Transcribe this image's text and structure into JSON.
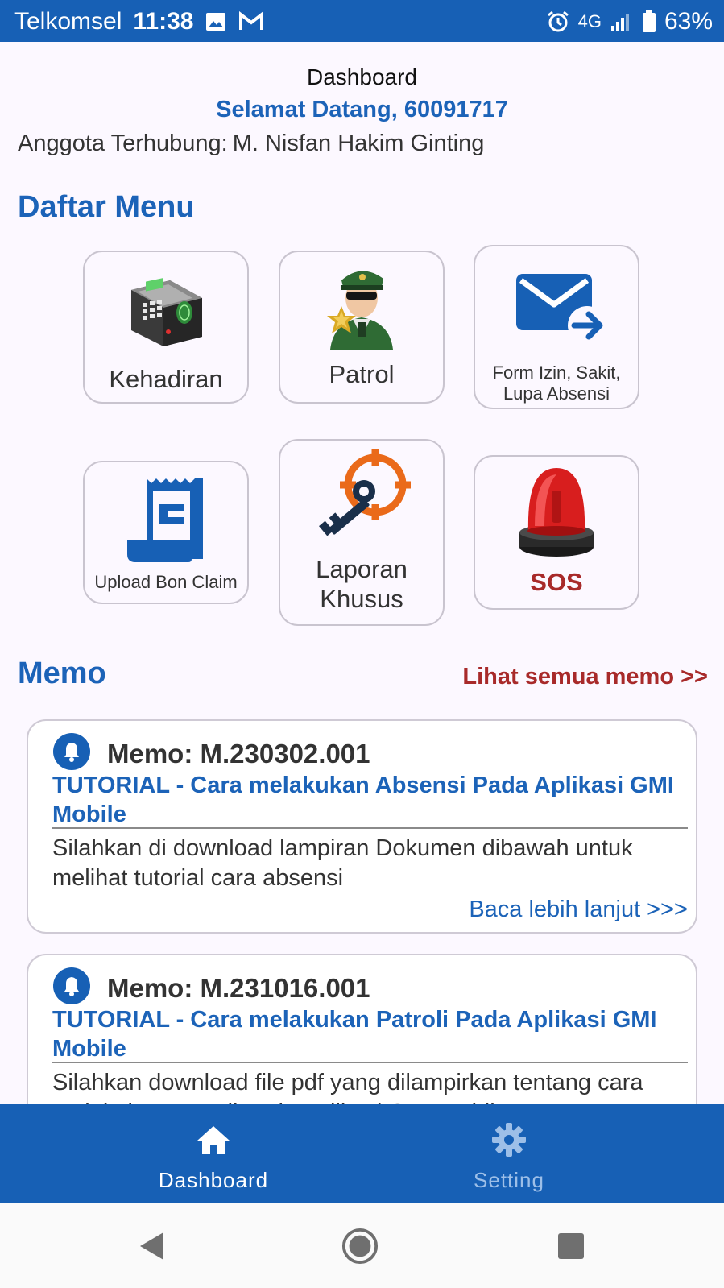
{
  "status_bar": {
    "carrier": "Telkomsel",
    "time": "11:38",
    "network": "4G",
    "battery": "63%"
  },
  "header": {
    "title": "Dashboard",
    "welcome": "Selamat Datang, 60091717",
    "member_label": "Anggota Terhubung:",
    "member_name": "M. Nisfan Hakim Ginting"
  },
  "menu": {
    "title": "Daftar Menu",
    "items": [
      {
        "label": "Kehadiran",
        "icon": "fingerprint-terminal-icon"
      },
      {
        "label": "Patrol",
        "icon": "security-officer-icon"
      },
      {
        "label": "Form Izin, Sakit, Lupa Absensi",
        "icon": "mail-forward-icon"
      },
      {
        "label": "Upload Bon Claim",
        "icon": "receipt-icon"
      },
      {
        "label": "Laporan Khusus",
        "icon": "key-target-icon"
      },
      {
        "label": "SOS",
        "icon": "siren-icon"
      }
    ]
  },
  "memo": {
    "title": "Memo",
    "view_all": "Lihat semua memo >>",
    "items": [
      {
        "number": "Memo: M.230302.001",
        "title": "TUTORIAL - Cara melakukan Absensi Pada Aplikasi GMI Mobile",
        "body": "Silahkan di download lampiran Dokumen dibawah untuk melihat tutorial cara absensi",
        "read_more": "Baca lebih lanjut >>>"
      },
      {
        "number": "Memo: M.231016.001",
        "title": "TUTORIAL - Cara melakukan Patroli Pada Aplikasi GMI Mobile",
        "body": "Silahkan download file pdf yang dilampirkan tentang cara melakukan Patroli pada Aplikasi GMI Mobile"
      }
    ]
  },
  "bottom_nav": {
    "items": [
      {
        "label": "Dashboard",
        "icon": "home-icon",
        "active": true
      },
      {
        "label": "Setting",
        "icon": "gear-icon",
        "active": false
      }
    ]
  },
  "colors": {
    "primary": "#1760b5",
    "accent_red": "#a82a2a",
    "background": "#fcf8ff"
  }
}
